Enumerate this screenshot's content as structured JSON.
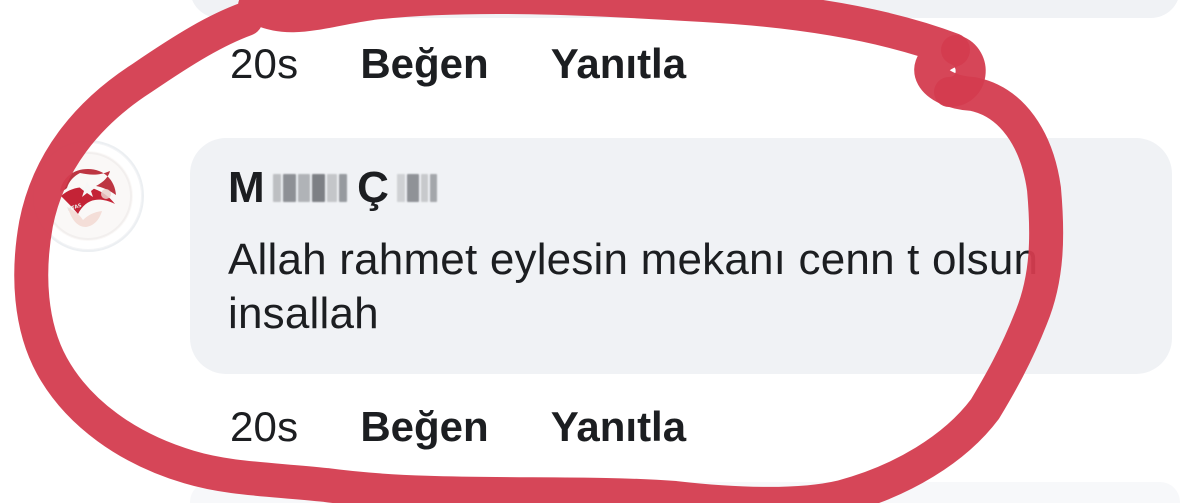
{
  "previous_comment": {
    "time": "20s",
    "like_label": "Beğen",
    "reply_label": "Yanıtla"
  },
  "comment": {
    "author_prefix": "M",
    "author_middle": "Ç",
    "text": "Allah rahmet eylesin mekanı cenn t olsun insallah",
    "time": "20s",
    "like_label": "Beğen",
    "reply_label": "Yanıtla"
  },
  "colors": {
    "bubble": "#f0f2f5",
    "text": "#1c1e21",
    "annotation": "#d43c4f",
    "avatar_red": "#b61f2e"
  },
  "icons": {
    "avatar": "emblem-avatar-icon"
  }
}
